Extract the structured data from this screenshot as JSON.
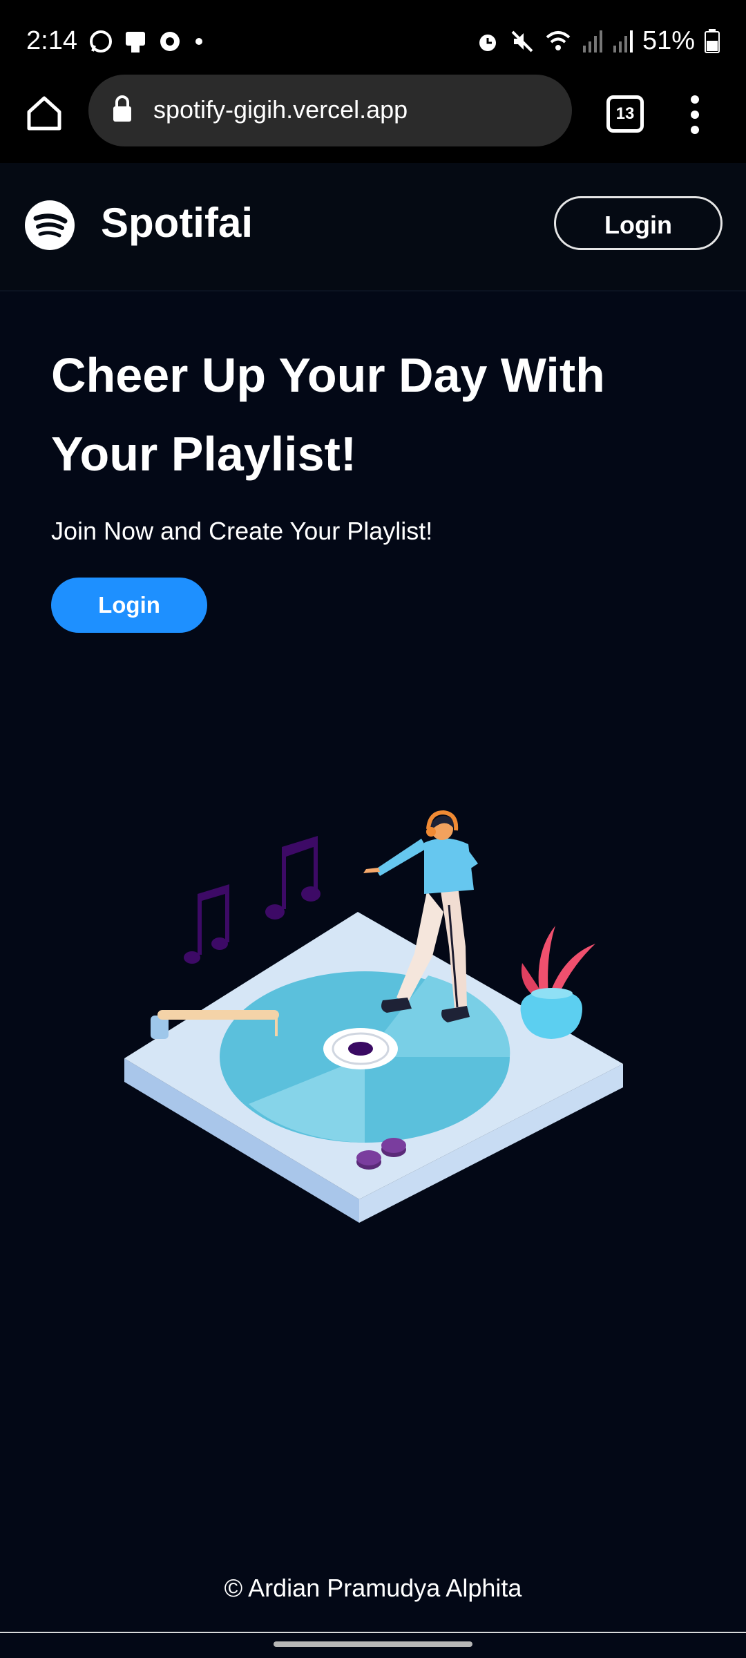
{
  "status_bar": {
    "time": "2:14",
    "battery": "51%",
    "icons_left": [
      "whatsapp-icon",
      "tablet-icon",
      "record-icon",
      "dot-icon"
    ],
    "icons_right": [
      "alarm-icon",
      "mute-icon",
      "wifi-icon",
      "signal-icon",
      "signal-icon",
      "battery-icon"
    ]
  },
  "browser": {
    "url": "spotify-gigih.vercel.app",
    "tabs_count": "13"
  },
  "header": {
    "brand": "Spotifai",
    "login_label": "Login"
  },
  "hero": {
    "title": "Cheer Up Your Day With Your Playlist!",
    "subtitle": "Join Now and Create Your Playlist!",
    "login_label": "Login"
  },
  "footer": {
    "text": "© Ardian Pramudya Alphita"
  },
  "colors": {
    "background": "#030816",
    "accent": "#1e90ff",
    "turntable_disk": "#5bc0dc"
  }
}
